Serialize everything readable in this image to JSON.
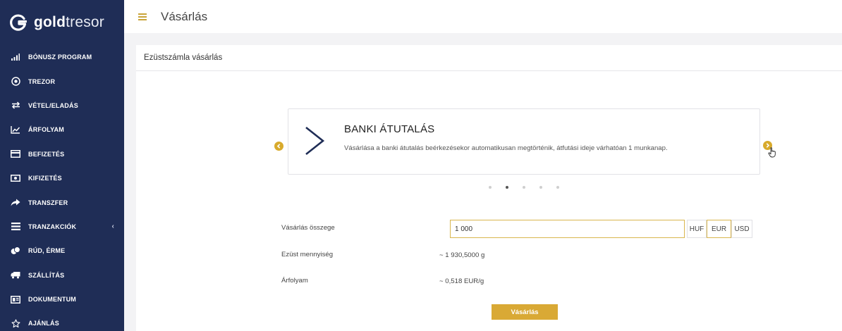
{
  "brand": {
    "logo_bold": "gold",
    "logo_light": "tresor",
    "accent": "#d9a935",
    "sidebar_bg": "#1f2d56"
  },
  "sidebar": {
    "items": [
      {
        "label": "BÓNUSZ PROGRAM",
        "icon": "bar-chart-icon"
      },
      {
        "label": "TREZOR",
        "icon": "vault-icon"
      },
      {
        "label": "VÉTEL/ELADÁS",
        "icon": "exchange-arrows-icon"
      },
      {
        "label": "ÁRFOLYAM",
        "icon": "line-chart-icon"
      },
      {
        "label": "BEFIZETÉS",
        "icon": "credit-card-icon"
      },
      {
        "label": "KIFIZETÉS",
        "icon": "banknote-icon"
      },
      {
        "label": "TRANSZFER",
        "icon": "share-arrow-icon"
      },
      {
        "label": "TRANZAKCIÓK",
        "icon": "list-icon",
        "chevron": "‹"
      },
      {
        "label": "RÚD, ÉRME",
        "icon": "coins-icon"
      },
      {
        "label": "SZÁLLÍTÁS",
        "icon": "truck-icon"
      },
      {
        "label": "DOKUMENTUM",
        "icon": "document-icon"
      },
      {
        "label": "AJÁNLÁS",
        "icon": "star-icon"
      }
    ]
  },
  "header": {
    "title": "Vásárlás"
  },
  "card": {
    "title": "Ezüstszámla vásárlás"
  },
  "carousel": {
    "slide_title": "BANKI ÁTUTALÁS",
    "slide_description": "Vásárlása a banki átutalás beérkezésekor automatikusan megtörténik, átfutási ideje várhatóan 1 munkanap.",
    "dot_count": 5,
    "active_dot": 1
  },
  "form": {
    "amount_label": "Vásárlás összege",
    "amount_value": "1 000",
    "currencies": [
      "HUF",
      "EUR",
      "USD"
    ],
    "selected_currency": "EUR",
    "quantity_label": "Ezüst mennyiség",
    "quantity_value": "~ 1 930,5000  g",
    "rate_label": "Árfolyam",
    "rate_value": "~ 0,518  EUR/g",
    "submit_label": "Vásárlás"
  }
}
